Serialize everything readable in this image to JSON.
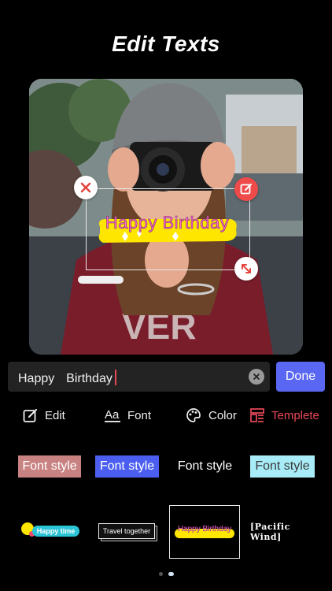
{
  "headline": "Edit Texts",
  "sticker": {
    "text": "Happy Birthday"
  },
  "input": {
    "value": "Happy  Birthday"
  },
  "done_label": "Done",
  "tools": [
    {
      "label": "Edit",
      "icon": "edit-icon"
    },
    {
      "label": "Font",
      "icon": "font-icon"
    },
    {
      "label": "Color",
      "icon": "palette-icon"
    },
    {
      "label": "Templete",
      "icon": "template-icon",
      "active": true
    }
  ],
  "styles": [
    {
      "label": "Font style",
      "bg": "#c98282",
      "color": "#ffffff"
    },
    {
      "label": "Font style",
      "bg": "#4b5ef0",
      "color": "#ffffff"
    },
    {
      "label": "Font style",
      "bg": "transparent",
      "color": "#ffffff"
    },
    {
      "label": "Font style",
      "bg": "#a8ecf7",
      "color": "#3a3a3a"
    }
  ],
  "templates": [
    {
      "label": "Happy time"
    },
    {
      "label": "Travel together"
    },
    {
      "label": "Happy Birthday",
      "selected": true
    },
    {
      "label": "Pacific Wind"
    }
  ],
  "colors": {
    "accent": "#5a67f2",
    "active_tool": "#e8485a",
    "edit_handle": "#f04b4b",
    "sticker_yellow": "#ffe600"
  }
}
